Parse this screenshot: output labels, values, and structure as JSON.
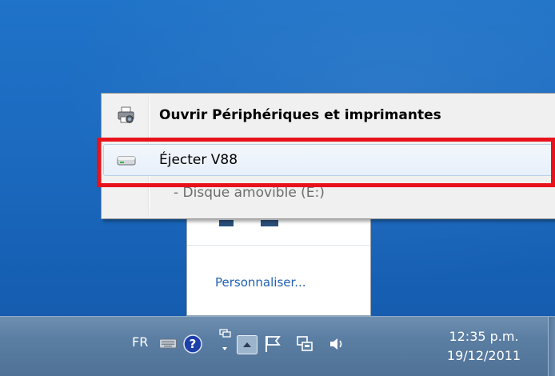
{
  "context_menu": {
    "open_devices_label": "Ouvrir Périphériques et imprimantes",
    "eject_label": "Éjecter V88",
    "disk_label": "-  Disque amovible (E:)"
  },
  "tray_panel": {
    "customize_label": "Personnaliser..."
  },
  "taskbar": {
    "language": "FR",
    "clock_time": "12:35 p.m.",
    "clock_date": "19/12/2011"
  },
  "colors": {
    "annotation": "#e8121a",
    "desktop": "#1b6ac0",
    "link": "#1f5fb4"
  },
  "icons": {
    "open_devices": "printer-icon",
    "eject": "drive-icon",
    "keyboard": "keyboard-icon",
    "help": "help-icon",
    "network": "network-icon",
    "show_hidden": "chevron-up-icon",
    "flag": "flag-icon",
    "usb": "usb-device-icon",
    "volume": "volume-icon"
  }
}
